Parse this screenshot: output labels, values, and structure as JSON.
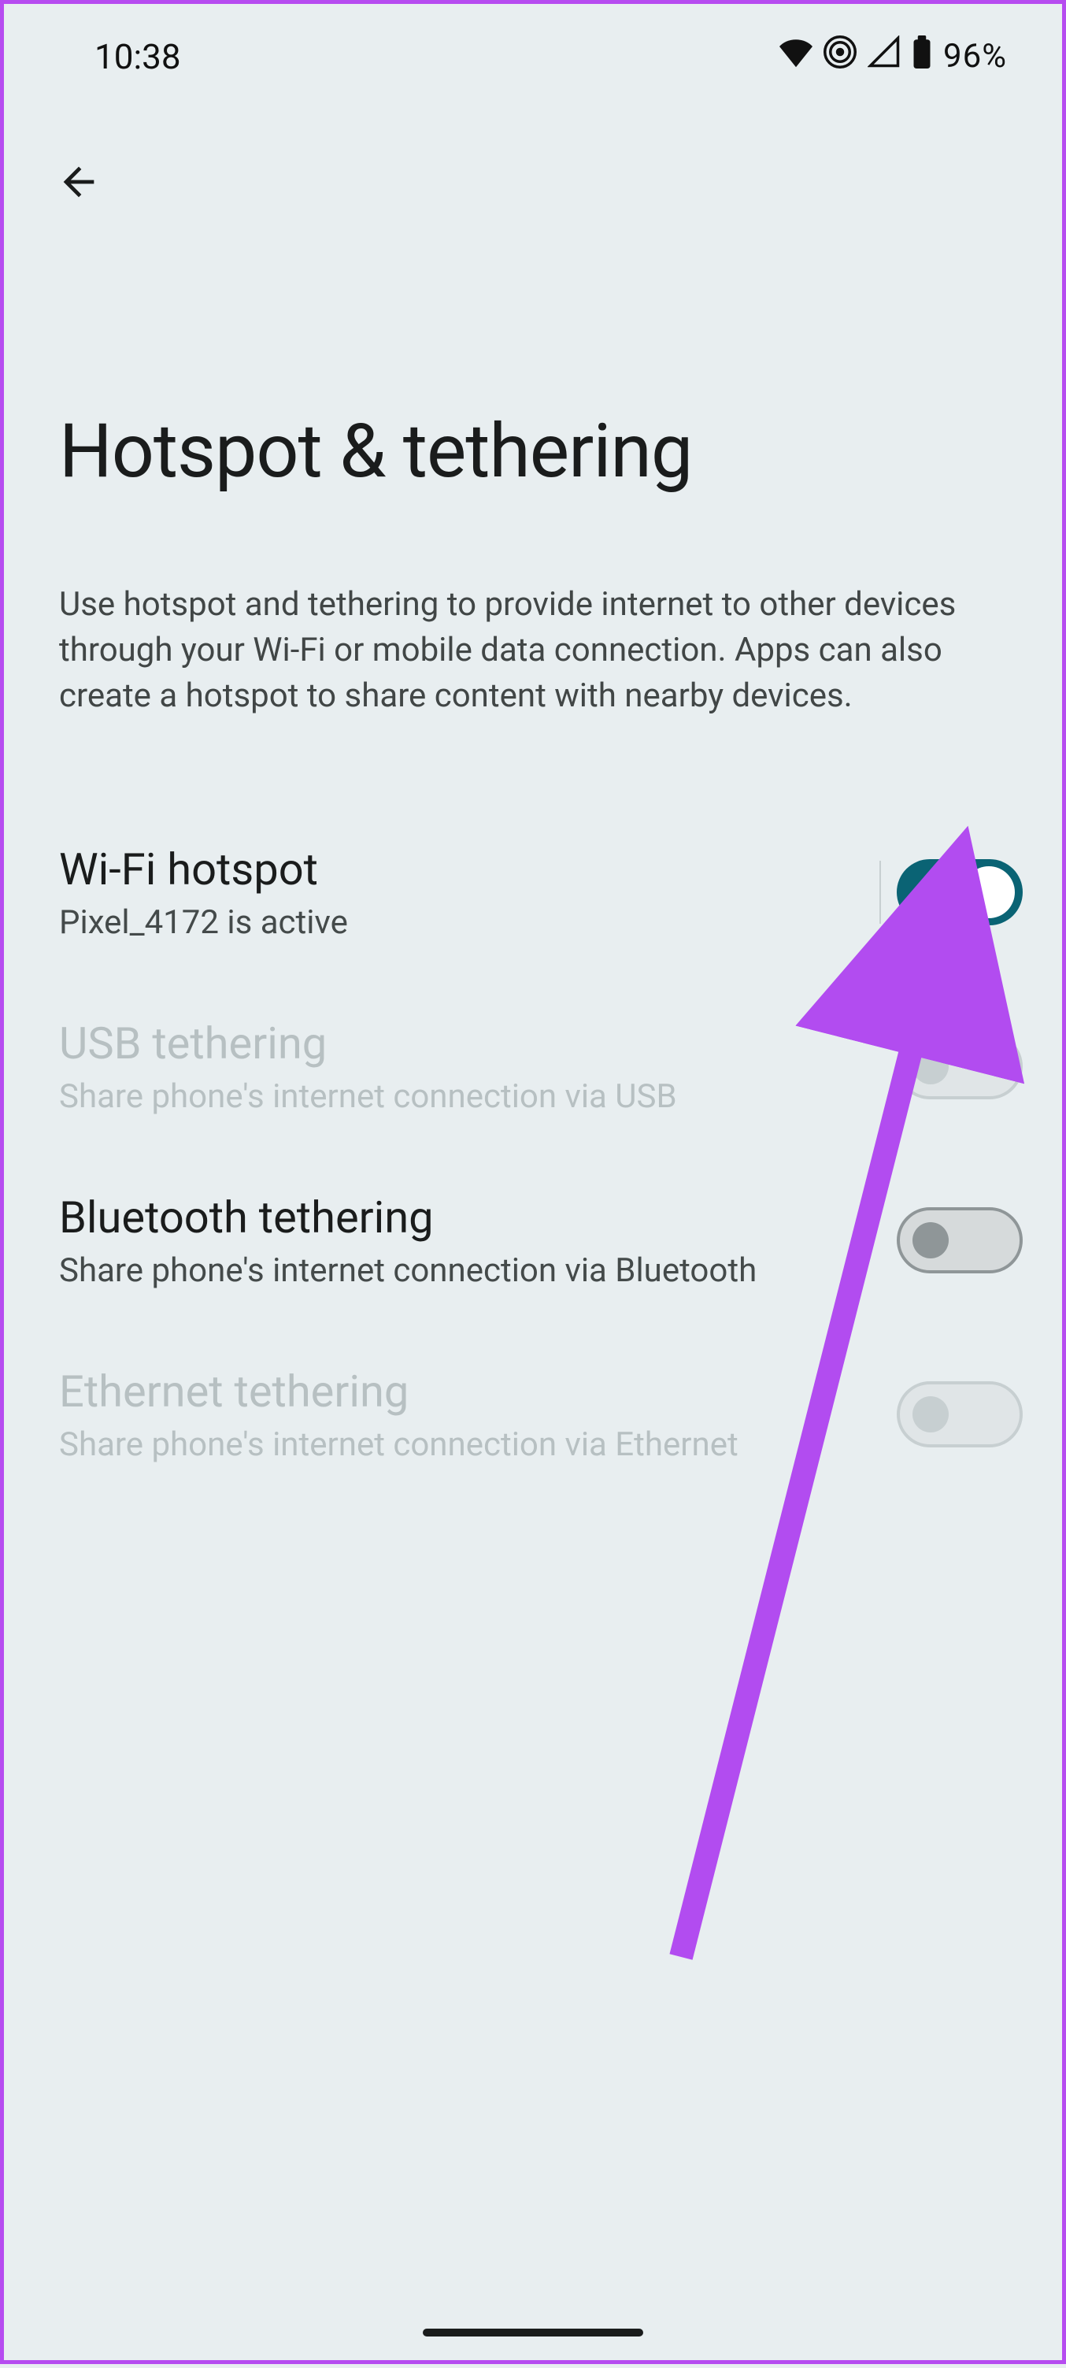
{
  "statusbar": {
    "time": "10:38",
    "battery_pct": "96%"
  },
  "page": {
    "title": "Hotspot & tethering",
    "description": "Use hotspot and tethering to provide internet to other devices through your Wi-Fi or mobile data connection. Apps can also create a hotspot to share content with nearby devices."
  },
  "items": [
    {
      "title": "Wi-Fi hotspot",
      "subtitle": "Pixel_4172 is active",
      "toggle_on": true,
      "enabled": true,
      "has_divider": true
    },
    {
      "title": "USB tethering",
      "subtitle": "Share phone's internet connection via USB",
      "toggle_on": false,
      "enabled": false,
      "has_divider": false
    },
    {
      "title": "Bluetooth tethering",
      "subtitle": "Share phone's internet connection via Bluetooth",
      "toggle_on": false,
      "enabled": true,
      "has_divider": false
    },
    {
      "title": "Ethernet tethering",
      "subtitle": "Share phone's internet connection via Ethernet",
      "toggle_on": false,
      "enabled": false,
      "has_divider": false
    }
  ],
  "annotation": {
    "arrow_color": "#b24cf0"
  }
}
